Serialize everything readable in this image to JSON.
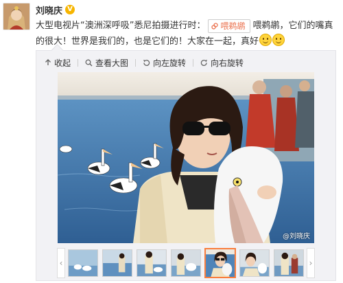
{
  "user": {
    "name": "刘晓庆",
    "verified_badge": "V"
  },
  "post": {
    "text_before_tag": "大型电视片“澳洲深呼吸”悉尼拍摄进行时：",
    "tag_label": "喂鹈鹕",
    "text_after_tag": "喂鹈鹕，它们的嘴真的很大！世界是我们的，也是它们的！大家在一起，真好",
    "emoji_icons": [
      "smile-emoji-icon",
      "smile-emoji-icon"
    ]
  },
  "toolbar": {
    "collapse_label": "收起",
    "view_large_label": "查看大图",
    "rotate_left_label": "向左旋转",
    "rotate_right_label": "向右旋转"
  },
  "photo": {
    "watermark": "@刘晓庆"
  },
  "thumbnails": {
    "count": 7,
    "active_index": 4,
    "prev_icon": "chevron-left-icon",
    "next_icon": "chevron-right-icon"
  },
  "colors": {
    "accent": "#eb7350",
    "active_border": "#fa7d3c",
    "verified": "#f7b500"
  }
}
